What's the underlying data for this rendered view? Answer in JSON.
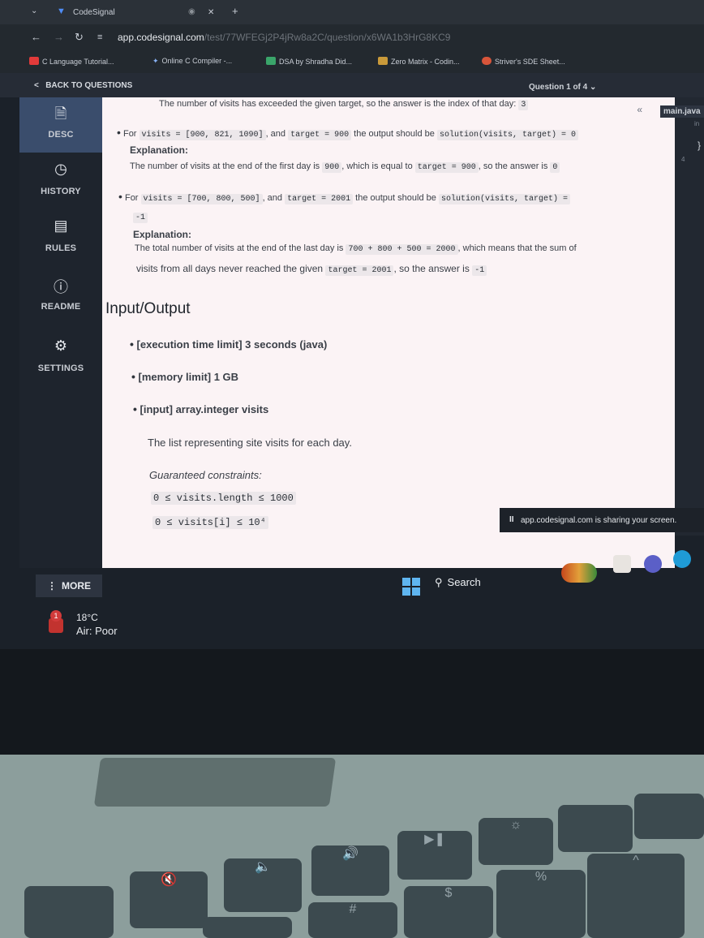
{
  "browser": {
    "tab_title": "CodeSignal",
    "url_host": "app.codesignal.com",
    "url_path": "/test/77WFEGj2P4jRw8a2C/question/x6WA1b3HrG8KC9",
    "bookmarks": [
      "C Language Tutorial...",
      "Online C Compiler -...",
      "DSA by Shradha Did...",
      "Zero Matrix - Codin...",
      "Striver's SDE Sheet..."
    ]
  },
  "app": {
    "back_label": "BACK TO QUESTIONS",
    "question_selector": "Question 1 of 4",
    "nav": [
      {
        "label": "DESC",
        "icon": "document-icon"
      },
      {
        "label": "HISTORY",
        "icon": "clock-icon"
      },
      {
        "label": "RULES",
        "icon": "list-icon"
      },
      {
        "label": "README",
        "icon": "info-icon"
      },
      {
        "label": "SETTINGS",
        "icon": "gear-icon"
      }
    ],
    "more_label": "MORE",
    "editor_file": "main.java"
  },
  "content": {
    "top_line_text": "The number of visits has exceeded the given target, so the answer is the index of that day:",
    "top_line_value": "3",
    "ex1": {
      "for": "For",
      "visits_code": "visits = [900, 821, 1090]",
      "and": ", and",
      "target_code": "target = 900",
      "output_text": "the output should be",
      "solution_code": "solution(visits, target) = 0",
      "explanation_label": "Explanation:",
      "explanation_text": "The number of visits at the end of the first day is",
      "expl_900": "900",
      "expl_mid": ", which is equal to",
      "expl_target": "target = 900",
      "expl_end": ", so the answer is",
      "expl_zero": "0"
    },
    "ex2": {
      "for": "For",
      "visits_code": "visits = [700, 800, 500]",
      "and": ", and",
      "target_code": "target = 2001",
      "output_text": "the output should be",
      "solution_code": "solution(visits, target) =",
      "solution_result": "-1",
      "explanation_label": "Explanation:",
      "expl_text1": "The total number of visits at the end of the last day is",
      "expl_sum": "700 + 800 + 500 = 2000",
      "expl_text2": ", which means that the sum of",
      "expl_text3": "visits from all days never reached the given",
      "expl_target": "target = 2001",
      "expl_text4": ", so the answer is",
      "expl_answer": "-1"
    },
    "io_heading": "Input/Output",
    "io": {
      "exec_label": "[execution time limit] 3 seconds (java)",
      "mem_label": "[memory limit] 1 GB",
      "input_label": "[input] array.integer visits",
      "input_desc": "The list representing site visits for each day.",
      "constraints_label": "Guaranteed constraints:",
      "c1": "0 ≤ visits.length ≤ 1000",
      "c2": "0 ≤ visits[i] ≤ 10⁴"
    }
  },
  "os": {
    "share_text": "app.codesignal.com is sharing your screen.",
    "search_label": "Search",
    "weather_temp": "18°C",
    "weather_air": "Air: Poor",
    "notif_count": "1"
  },
  "colors": {
    "accent": "#3a4d6c",
    "content_bg": "#fbf3f5",
    "sidebar_bg": "#1e242d"
  }
}
